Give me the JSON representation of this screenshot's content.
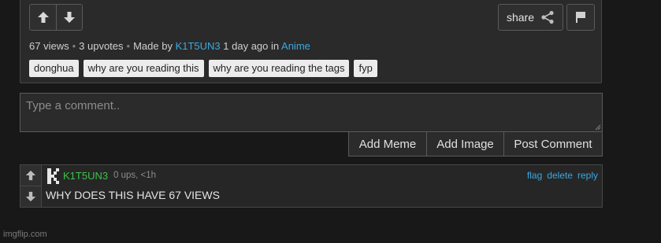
{
  "post": {
    "views": "67 views",
    "upvotes": "3 upvotes",
    "made_by_label": "Made by",
    "author": "K1T5UN3",
    "time_label": "1 day ago in",
    "stream": "Anime",
    "share_label": "share",
    "tags": [
      "donghua",
      "why are you reading this",
      "why are you reading the tags",
      "fyp"
    ]
  },
  "comment_form": {
    "placeholder": "Type a comment..",
    "add_meme": "Add Meme",
    "add_image": "Add Image",
    "post_comment": "Post Comment"
  },
  "comment": {
    "user": "K1T5UN3",
    "meta": "0 ups, <1h",
    "flag": "flag",
    "delete": "delete",
    "reply": "reply",
    "text": "WHY DOES THIS HAVE 67 VIEWS"
  },
  "footer": {
    "watermark": "imgflip.com"
  },
  "colors": {
    "link_blue": "#3ba8e0",
    "username_green": "#3cc14a",
    "background": "#181818",
    "panel": "#2a2a2a"
  },
  "icons": [
    "arrow-up-icon",
    "arrow-down-icon",
    "share-icon",
    "flag-icon",
    "avatar-k-icon"
  ]
}
